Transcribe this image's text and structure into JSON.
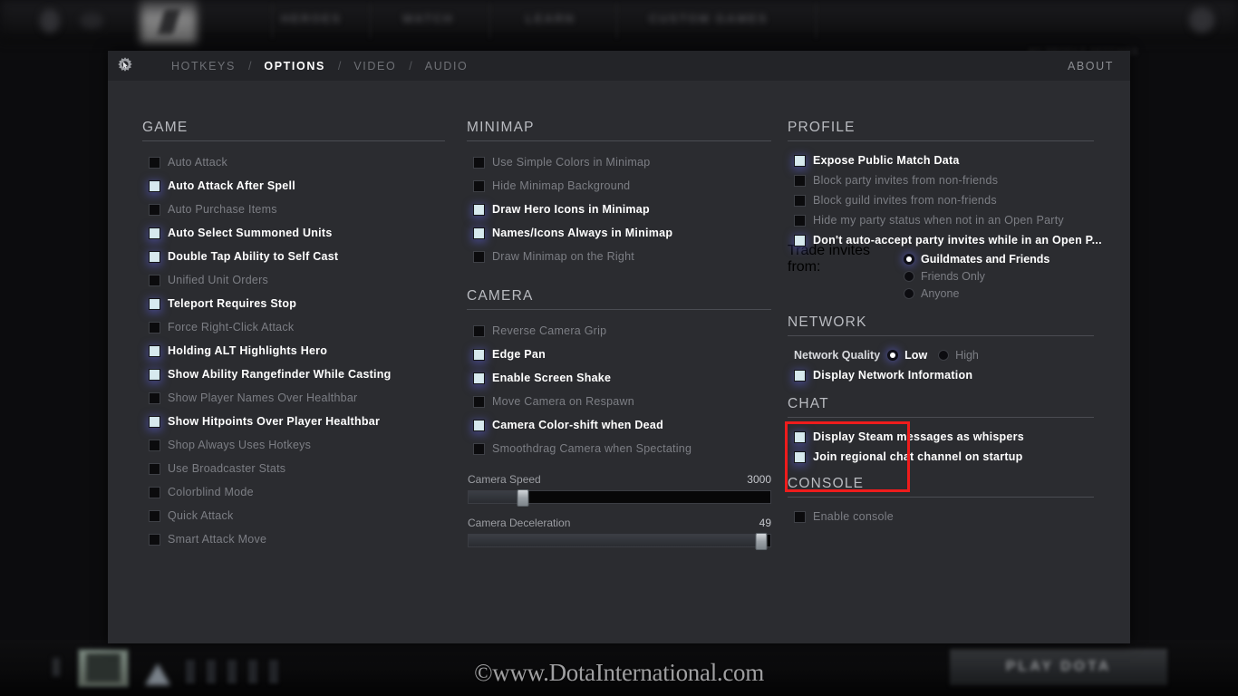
{
  "background": {
    "nav_items": [
      "HEROES",
      "WATCH",
      "LEARN",
      "CUSTOM GAMES"
    ],
    "top_right_text": "MY PROFILE    SETTINGS",
    "bottom_play_button": "PLAY DOTA",
    "watermark": "©www.DotaInternational.com"
  },
  "header": {
    "gear_icon": "gear-cursor-icon",
    "separator": "/",
    "tabs": [
      {
        "label": "HOTKEYS",
        "active": false
      },
      {
        "label": "OPTIONS",
        "active": true
      },
      {
        "label": "VIDEO",
        "active": false
      },
      {
        "label": "AUDIO",
        "active": false
      }
    ],
    "about_label": "ABOUT"
  },
  "game": {
    "title": "GAME",
    "items": [
      {
        "label": "Auto Attack",
        "checked": false
      },
      {
        "label": "Auto Attack After Spell",
        "checked": true
      },
      {
        "label": "Auto Purchase Items",
        "checked": false
      },
      {
        "label": "Auto Select Summoned Units",
        "checked": true
      },
      {
        "label": "Double Tap Ability to Self Cast",
        "checked": true
      },
      {
        "label": "Unified Unit Orders",
        "checked": false
      },
      {
        "label": "Teleport Requires Stop",
        "checked": true
      },
      {
        "label": "Force Right-Click Attack",
        "checked": false
      },
      {
        "label": "Holding ALT Highlights Hero",
        "checked": true
      },
      {
        "label": "Show Ability Rangefinder While Casting",
        "checked": true
      },
      {
        "label": "Show Player Names Over Healthbar",
        "checked": false
      },
      {
        "label": "Show Hitpoints Over Player Healthbar",
        "checked": true
      },
      {
        "label": "Shop Always Uses Hotkeys",
        "checked": false
      },
      {
        "label": "Use Broadcaster Stats",
        "checked": false
      },
      {
        "label": "Colorblind Mode",
        "checked": false
      },
      {
        "label": "Quick Attack",
        "checked": false
      },
      {
        "label": "Smart Attack Move",
        "checked": false
      }
    ]
  },
  "minimap": {
    "title": "MINIMAP",
    "items": [
      {
        "label": "Use Simple Colors in Minimap",
        "checked": false
      },
      {
        "label": "Hide Minimap Background",
        "checked": false
      },
      {
        "label": "Draw Hero Icons in Minimap",
        "checked": true
      },
      {
        "label": "Names/Icons Always in Minimap",
        "checked": true
      },
      {
        "label": "Draw Minimap on the Right",
        "checked": false
      }
    ]
  },
  "camera": {
    "title": "CAMERA",
    "items": [
      {
        "label": "Reverse Camera Grip",
        "checked": false
      },
      {
        "label": "Edge Pan",
        "checked": true
      },
      {
        "label": "Enable Screen Shake",
        "checked": true
      },
      {
        "label": "Move Camera on Respawn",
        "checked": false
      },
      {
        "label": "Camera Color-shift when Dead",
        "checked": true
      },
      {
        "label": "Smoothdrag Camera when Spectating",
        "checked": false
      }
    ],
    "sliders": [
      {
        "label": "Camera Speed",
        "value": "3000",
        "percent": 18
      },
      {
        "label": "Camera Deceleration",
        "value": "49",
        "percent": 97
      }
    ]
  },
  "profile": {
    "title": "PROFILE",
    "items": [
      {
        "label": "Expose Public Match Data",
        "checked": true
      },
      {
        "label": "Block party invites from non-friends",
        "checked": false
      },
      {
        "label": "Block guild invites from non-friends",
        "checked": false
      },
      {
        "label": "Hide my party status when not in an Open Party",
        "checked": false
      },
      {
        "label": "Don't auto-accept party invites while in an Open P...",
        "checked": true
      }
    ],
    "trade_invites": {
      "label": "Trade invites from:",
      "options": [
        {
          "label": "Guildmates and Friends",
          "selected": true
        },
        {
          "label": "Friends Only",
          "selected": false
        },
        {
          "label": "Anyone",
          "selected": false
        }
      ]
    }
  },
  "network": {
    "title": "NETWORK",
    "quality_label": "Network Quality",
    "quality_options": [
      {
        "label": "Low",
        "selected": true
      },
      {
        "label": "High",
        "selected": false
      }
    ],
    "items": [
      {
        "label": "Display Network Information",
        "checked": true
      }
    ]
  },
  "chat": {
    "title": "CHAT",
    "items": [
      {
        "label": "Display Steam messages as whispers",
        "checked": true
      },
      {
        "label": "Join regional chat channel on startup",
        "checked": true
      }
    ]
  },
  "console": {
    "title": "CONSOLE",
    "items": [
      {
        "label": "Enable console",
        "checked": false
      }
    ],
    "highlight_color": "#ee1c1c"
  }
}
